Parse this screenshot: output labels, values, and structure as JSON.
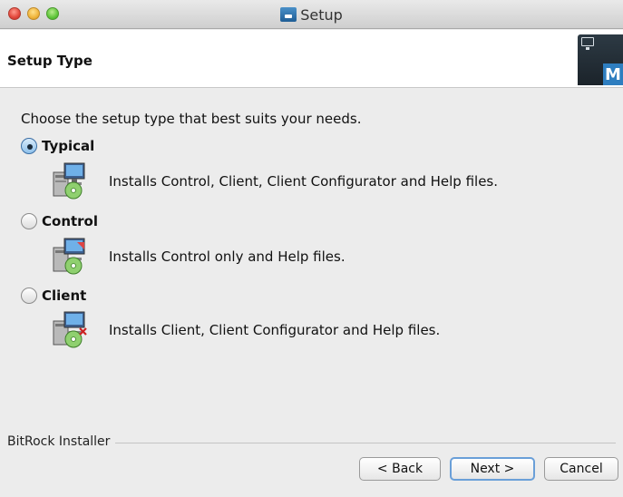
{
  "window": {
    "title": "Setup"
  },
  "header": {
    "title": "Setup Type",
    "logo_letter": "M"
  },
  "content": {
    "intro": "Choose the setup type that best suits your needs.",
    "options": [
      {
        "label": "Typical",
        "description": "Installs Control, Client, Client Configurator and Help files.",
        "selected": true,
        "icon": "installer-package-icon"
      },
      {
        "label": "Control",
        "description": "Installs Control only and Help files.",
        "selected": false,
        "icon": "installer-package-icon"
      },
      {
        "label": "Client",
        "description": "Installs Client, Client Configurator and Help files.",
        "selected": false,
        "icon": "installer-package-icon"
      }
    ]
  },
  "footer": {
    "brand": "BitRock Installer",
    "back_label": "< Back",
    "next_label": "Next >",
    "cancel_label": "Cancel"
  },
  "colors": {
    "window_bg": "#ececec",
    "header_bg": "#ffffff",
    "default_button_ring": "#6a9fd8",
    "radio_selected": "#8ec0ea"
  }
}
